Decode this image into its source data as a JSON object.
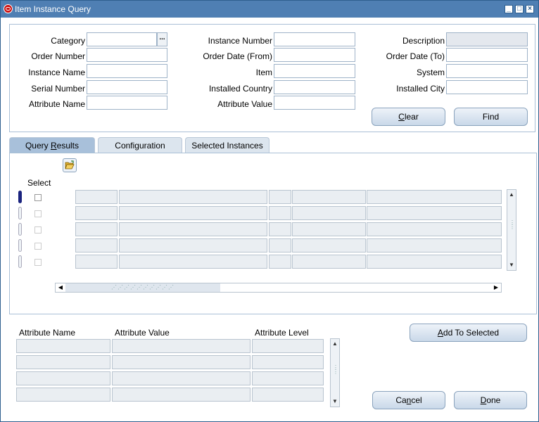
{
  "window": {
    "title": "Item Instance Query"
  },
  "query_form": {
    "labels": {
      "category": "Category",
      "order_number": "Order Number",
      "instance_name": "Instance Name",
      "serial_number": "Serial Number",
      "attribute_name": "Attribute Name",
      "instance_number": "Instance Number",
      "order_date_from": "Order Date (From)",
      "item": "Item",
      "installed_country": "Installed Country",
      "attribute_value": "Attribute Value",
      "description": "Description",
      "order_date_to": "Order Date (To)",
      "system": "System",
      "installed_city": "Installed City"
    },
    "lov_button": "...",
    "clear_button": {
      "pre": "",
      "ul": "C",
      "post": "lear"
    },
    "find_button": "Find"
  },
  "tabs": [
    {
      "pre": "Query ",
      "ul": "R",
      "post": "esults",
      "active": true
    },
    {
      "pre": "Configuration",
      "ul": "",
      "post": "",
      "active": false
    },
    {
      "pre": "Selected Instances",
      "ul": "",
      "post": "",
      "active": false
    }
  ],
  "results": {
    "select_header": "Select",
    "rows": 5,
    "open_folder_icon": "folder-open-icon"
  },
  "attributes": {
    "headers": {
      "name": "Attribute Name",
      "value": "Attribute Value",
      "level": "Attribute Level"
    },
    "rows": 4,
    "add_button": {
      "pre": "",
      "ul": "A",
      "post": "dd To Selected"
    }
  },
  "footer": {
    "cancel_button": {
      "pre": "Ca",
      "ul": "n",
      "post": "cel"
    },
    "done_button": {
      "pre": "",
      "ul": "D",
      "post": "one"
    }
  },
  "colors": {
    "titlebar": "#4f7fb3",
    "active_tab": "#a8c0da",
    "current_row": "#1a237e"
  }
}
